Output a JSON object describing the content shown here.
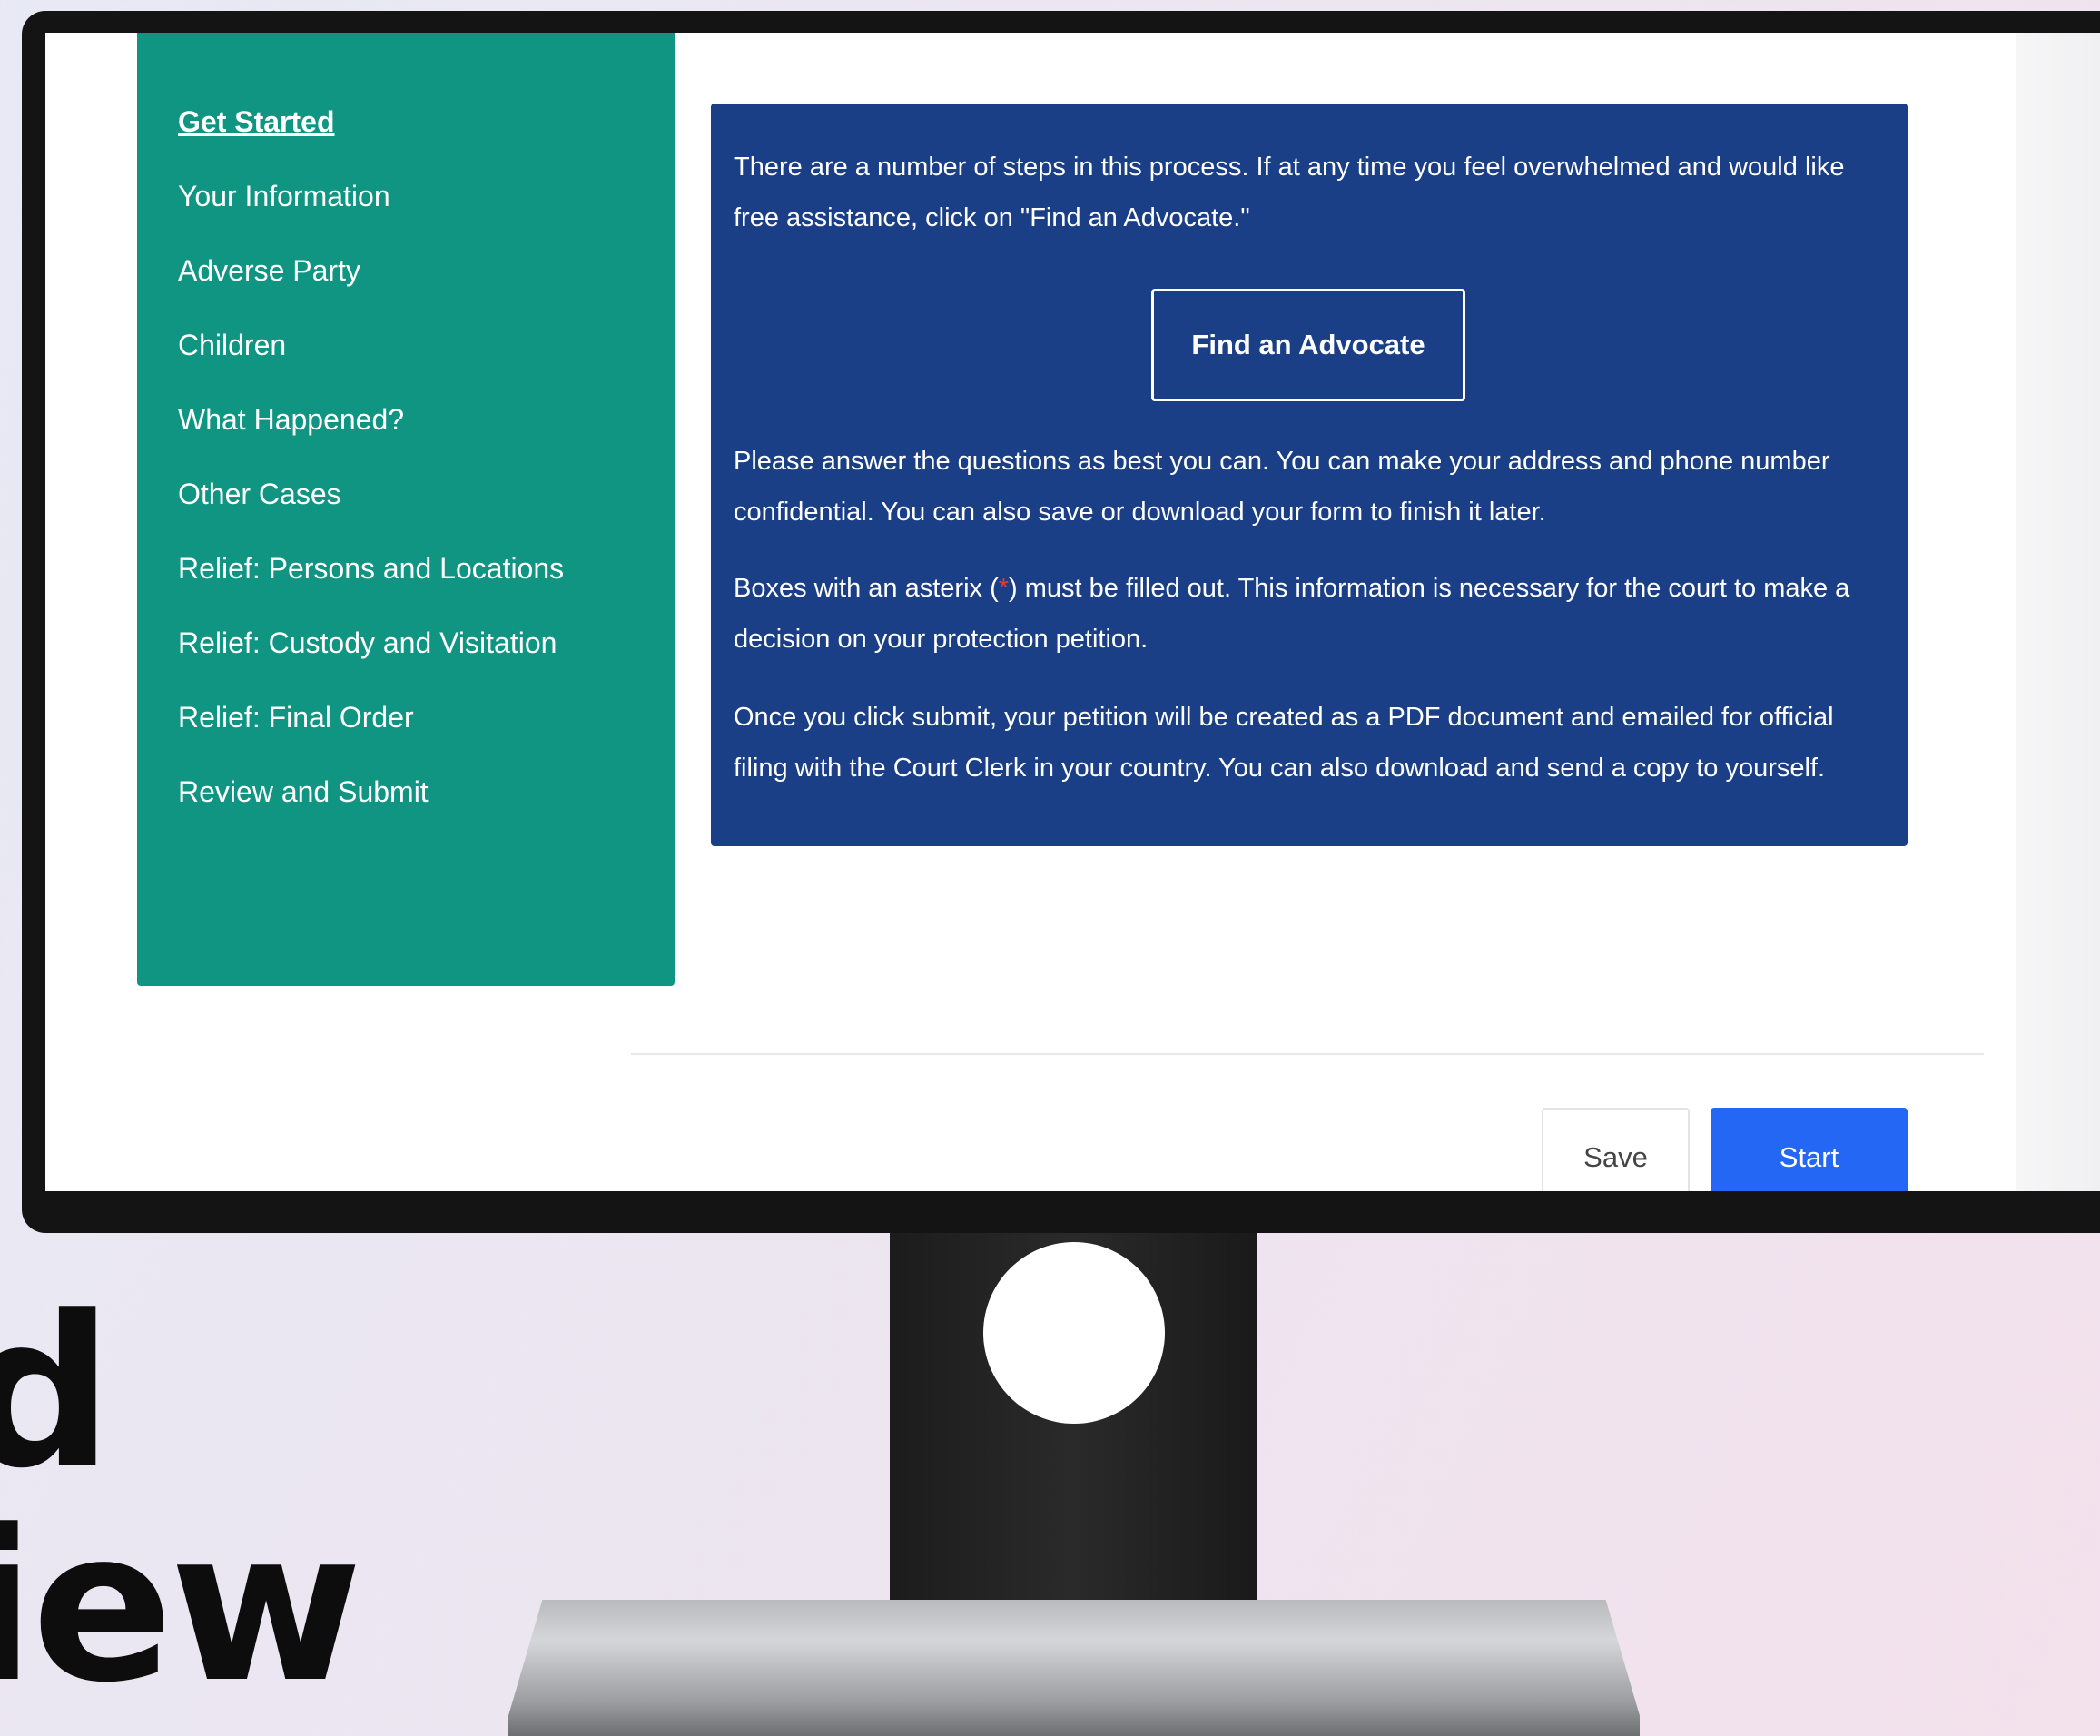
{
  "sidebar": {
    "items": [
      {
        "label": "Get Started"
      },
      {
        "label": "Your Information"
      },
      {
        "label": "Adverse Party"
      },
      {
        "label": "Children"
      },
      {
        "label": "What Happened?"
      },
      {
        "label": "Other Cases"
      },
      {
        "label": "Relief: Persons and Locations"
      },
      {
        "label": "Relief: Custody and Visitation"
      },
      {
        "label": "Relief: Final Order"
      },
      {
        "label": "Review and Submit"
      }
    ],
    "active_index": 0
  },
  "info": {
    "p1": "There are a number of steps in this process. If at any time you feel overwhelmed and would like free assistance, click on \"Find an Advocate.\"",
    "advocate_button": "Find an Advocate",
    "p2": "Please answer the questions as best you can. You can make your address and phone number confidential.  You can also save or download your form to finish it later.",
    "p3_before": "Boxes with an asterix (",
    "p3_asterisk": "*",
    "p3_after": ") must be filled out. This information is necessary for the court to make a decision on your protection petition.",
    "p4": "Once you click submit,  your petition will be created as a PDF document and emailed for official filing with the Court Clerk in your country.  You can also download and send a copy to yourself."
  },
  "footer": {
    "save_label": "Save",
    "start_label": "Start"
  },
  "overlay_text": {
    "line1": "d",
    "line2": "iew"
  },
  "colors": {
    "sidebar": "#0f9582",
    "info_box": "#1b3f86",
    "start_button": "#2467f5",
    "asterisk": "#e23b3b"
  }
}
